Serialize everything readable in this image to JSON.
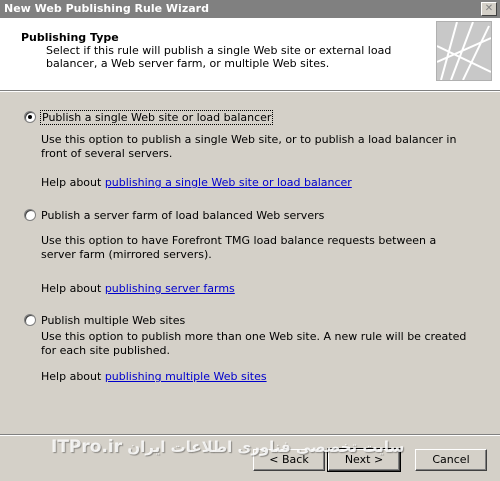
{
  "window": {
    "title": "New Web Publishing Rule Wizard",
    "close_glyph": "✕"
  },
  "header": {
    "title": "Publishing Type",
    "description": "Select if this rule will publish a single Web site or external load balancer, a Web server farm, or multiple Web sites."
  },
  "options": [
    {
      "label": "Publish a single Web site or load balancer",
      "checked": true,
      "description": "Use this option to publish a single Web site, or to publish a load balancer in front of several servers.",
      "help_prefix": "Help about ",
      "help_link": "publishing a single Web site or load balancer"
    },
    {
      "label": "Publish a server farm of load balanced Web servers",
      "checked": false,
      "description": "Use this option to have Forefront TMG load balance requests between a server farm (mirrored servers).",
      "help_prefix": "Help about ",
      "help_link": "publishing server farms"
    },
    {
      "label": "Publish multiple Web sites",
      "checked": false,
      "description": "Use this option to publish more than one Web site. A new rule will be created for each site published.",
      "help_prefix": "Help about ",
      "help_link": "publishing multiple Web sites"
    }
  ],
  "buttons": {
    "back": "< Back",
    "next": "Next >",
    "cancel": "Cancel"
  },
  "watermark": {
    "text": "سایت تخصصی فناوری اطلاعات ایران",
    "brand": "ITPro.ir"
  }
}
